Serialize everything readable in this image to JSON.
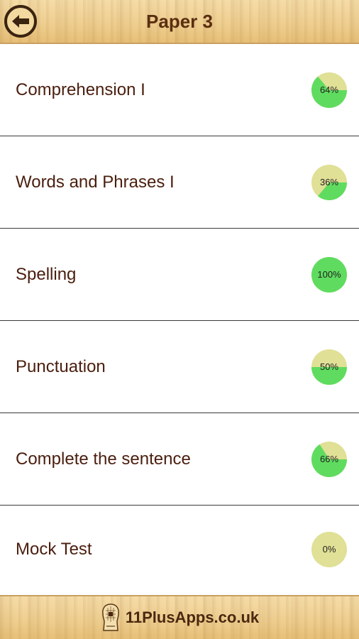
{
  "header": {
    "title": "Paper 3",
    "back_icon": "back-arrow-icon"
  },
  "colors": {
    "progress_done": "#5fdc5f",
    "progress_remaining": "#e0e096",
    "label_text": "#4a1e0e",
    "title_text": "#5a2e10"
  },
  "items": [
    {
      "label": "Comprehension I",
      "progress": 64,
      "progress_text": "64%"
    },
    {
      "label": "Words and Phrases I",
      "progress": 36,
      "progress_text": "36%"
    },
    {
      "label": "Spelling",
      "progress": 100,
      "progress_text": "100%"
    },
    {
      "label": "Punctuation",
      "progress": 50,
      "progress_text": "50%"
    },
    {
      "label": "Complete the sentence",
      "progress": 66,
      "progress_text": "66%"
    },
    {
      "label": "Mock Test",
      "progress": 0,
      "progress_text": "0%"
    }
  ],
  "footer": {
    "logo_icon": "head-brain-logo-icon",
    "text": "11PlusApps.co.uk"
  }
}
